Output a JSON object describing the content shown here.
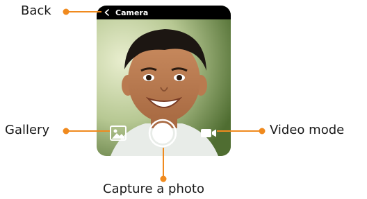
{
  "app": {
    "title": "Camera"
  },
  "controls": {
    "back": "back",
    "gallery": "gallery",
    "capture": "capture",
    "video": "video"
  },
  "callouts": {
    "back": "Back",
    "gallery": "Gallery",
    "capture": "Capture a photo",
    "video": "Video mode"
  },
  "colors": {
    "callout_accent": "#F08A1E",
    "topbar": "#000000",
    "icon": "#FFFFFF"
  }
}
